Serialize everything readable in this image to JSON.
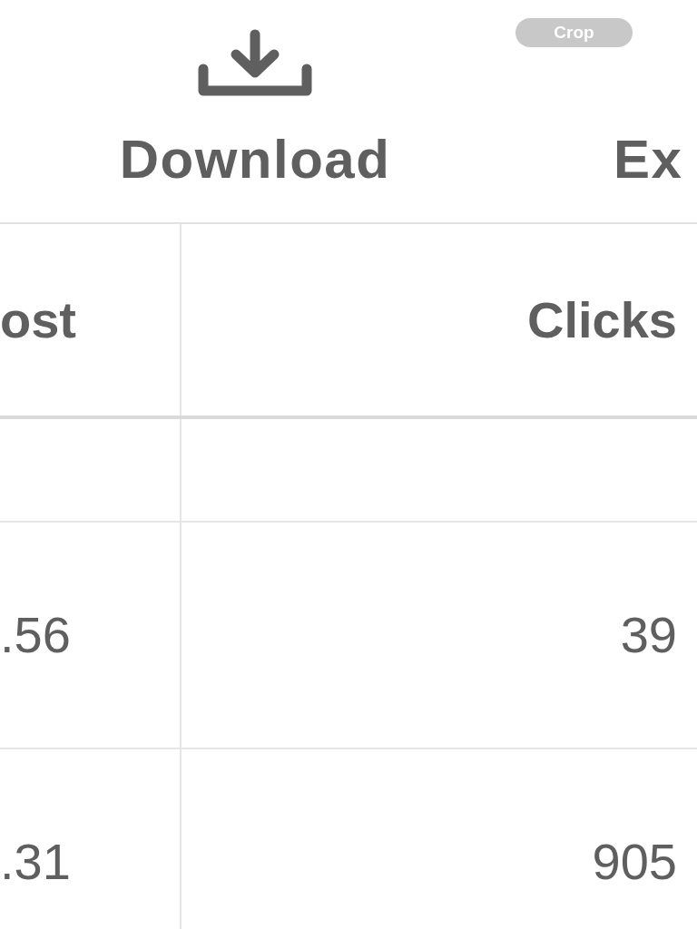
{
  "crop_badge": "Crop",
  "toolbar": [
    {
      "label": "Download",
      "kind": "download"
    },
    {
      "label": "Ex",
      "kind": "partial"
    }
  ],
  "table": {
    "columns": [
      "ost",
      "Clicks"
    ],
    "rows": [
      {
        "cells": [
          "",
          ""
        ]
      },
      {
        "cells": [
          ".56",
          "39"
        ]
      },
      {
        "cells": [
          ".31",
          "905"
        ]
      }
    ]
  }
}
